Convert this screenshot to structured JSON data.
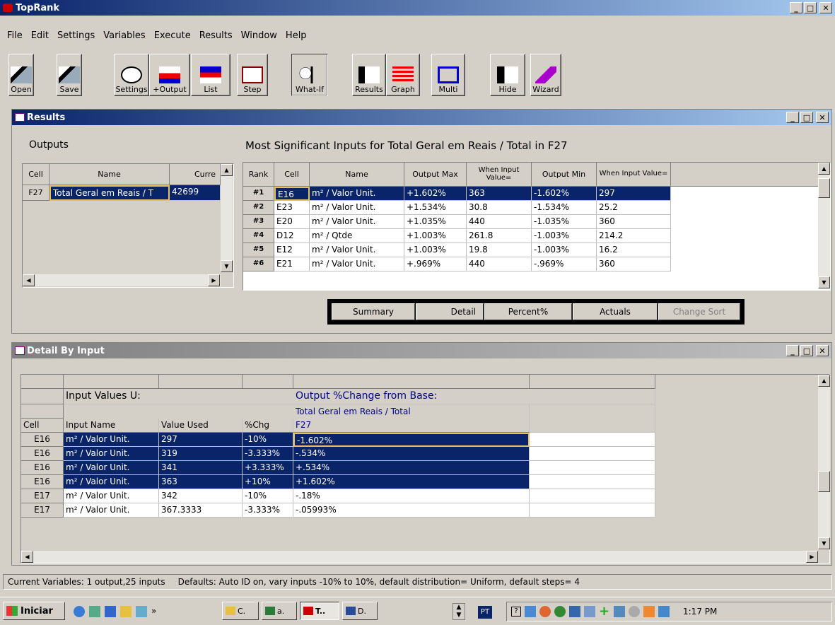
{
  "app": {
    "title": "TopRank",
    "menu": [
      "File",
      "Edit",
      "Settings",
      "Variables",
      "Execute",
      "Results",
      "Window",
      "Help"
    ]
  },
  "toolbar": [
    {
      "label": "Open",
      "icon": "open-icon"
    },
    {
      "label": "Save",
      "icon": "save-icon"
    },
    {
      "label": "Settings",
      "icon": "settings-icon"
    },
    {
      "label": "+Output",
      "icon": "add-output-icon"
    },
    {
      "label": "List",
      "icon": "list-icon"
    },
    {
      "label": "Step",
      "icon": "step-icon"
    },
    {
      "label": "What-If",
      "icon": "what-if-icon"
    },
    {
      "label": "Results",
      "icon": "results-icon"
    },
    {
      "label": "Graph",
      "icon": "graph-icon"
    },
    {
      "label": "Multi",
      "icon": "multi-icon"
    },
    {
      "label": "Hide",
      "icon": "hide-icon"
    },
    {
      "label": "Wizard",
      "icon": "wizard-icon"
    }
  ],
  "results": {
    "title": "Results",
    "outputs_label": "Outputs",
    "outputs_headers": [
      "Cell",
      "Name",
      "Curre"
    ],
    "outputs_row": [
      "F27",
      "Total Geral em Reais / T",
      "42699"
    ],
    "heading": "Most Significant Inputs for Total Geral em Reais / Total in F27",
    "headers": [
      "Rank",
      "Cell",
      "Name",
      "Output Max",
      "When Input Value=",
      "Output Min",
      "When Input Value="
    ],
    "rows": [
      [
        "#1",
        "E16",
        "m² / Valor Unit.",
        "+1.602%",
        "363",
        "-1.602%",
        "297"
      ],
      [
        "#2",
        "E23",
        "m² / Valor Unit.",
        "+1.534%",
        "30.8",
        "-1.534%",
        "25.2"
      ],
      [
        "#3",
        "E20",
        "m² / Valor Unit.",
        "+1.035%",
        "440",
        "-1.035%",
        "360"
      ],
      [
        "#4",
        "D12",
        "m² / Qtde",
        "+1.003%",
        "261.8",
        "-1.003%",
        "214.2"
      ],
      [
        "#5",
        "E12",
        "m² / Valor Unit.",
        "+1.003%",
        "19.8",
        "-1.003%",
        "16.2"
      ],
      [
        "#6",
        "E21",
        "m² / Valor Unit.",
        "+.969%",
        "440",
        "-.969%",
        "360"
      ]
    ],
    "buttons": [
      "Summary",
      "Detail",
      "Percent%",
      "Actuals",
      "Change Sort"
    ]
  },
  "detail": {
    "title": "Detail By Input",
    "input_values": "Input Values U:",
    "output_change": "Output %Change from Base:",
    "output_name": "Total Geral em Reais / Total",
    "output_cell": "F27",
    "headers": [
      "Cell",
      "Input Name",
      "Value Used",
      "%Chg"
    ],
    "rows": [
      [
        "E16",
        "m² / Valor Unit.",
        "297",
        "-10%",
        "-1.602%"
      ],
      [
        "E16",
        "m² / Valor Unit.",
        "319",
        "-3.333%",
        "-.534%"
      ],
      [
        "E16",
        "m² / Valor Unit.",
        "341",
        "+3.333%",
        "+.534%"
      ],
      [
        "E16",
        "m² / Valor Unit.",
        "363",
        "+10%",
        "+1.602%"
      ],
      [
        "E17",
        "m² / Valor Unit.",
        "342",
        "-10%",
        "-.18%"
      ],
      [
        "E17",
        "m² / Valor Unit.",
        "367.3333",
        "-3.333%",
        "-.05993%"
      ]
    ]
  },
  "status": {
    "text": "Current Variables: 1 output,25 inputs",
    "defaults": "Defaults:  Auto ID on,  vary inputs -10% to 10%,  default distribution= Uniform,  default steps= 4"
  },
  "taskbar": {
    "start": "Iniciar",
    "tasks": [
      "C.",
      "a.",
      "T..",
      "D."
    ],
    "lang": "PT",
    "time": "1:17 PM"
  }
}
